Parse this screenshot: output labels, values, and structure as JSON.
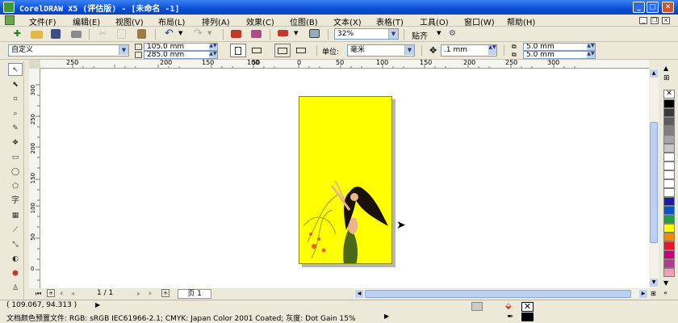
{
  "title": "CorelDRAW X5 (评估版) - [未命名 -1]",
  "window_buttons": {
    "minimize": "_",
    "maximize": "□",
    "close": "✕"
  },
  "menu": [
    "文件(F)",
    "编辑(E)",
    "视图(V)",
    "布局(L)",
    "排列(A)",
    "效果(C)",
    "位图(B)",
    "文本(X)",
    "表格(T)",
    "工具(O)",
    "窗口(W)",
    "帮助(H)"
  ],
  "toolbar": {
    "zoom": "32%",
    "snap": "贴齐"
  },
  "property_bar": {
    "paper_preset": "自定义",
    "width": "105.0 mm",
    "height": "285.0 mm",
    "unit_label": "单位:",
    "unit": "毫米",
    "nudge": ".1 mm",
    "dup_x": "5.0 mm",
    "dup_y": "5.0 mm"
  },
  "ruler": {
    "h_ticks": [
      "250",
      "200",
      "150",
      "100",
      "50",
      "0",
      "50",
      "100",
      "150",
      "200",
      "250",
      "300"
    ],
    "v_ticks": [
      "300",
      "250",
      "200",
      "150",
      "100",
      "50",
      "0"
    ]
  },
  "page_nav": {
    "position": "1 / 1",
    "tab": "页 1"
  },
  "status": {
    "coords": "( 109.067, 94.313 )",
    "profile": "文档颜色预置文件: RGB: sRGB IEC61966-2.1; CMYK: Japan Color 2001 Coated; 灰度: Dot Gain 15%"
  },
  "palette": [
    "#000000",
    "#3a3a3a",
    "#5e5e5e",
    "#808080",
    "#a5a5a5",
    "#c8c8c8",
    "#ffffff",
    "#ffffff",
    "#ffffff",
    "#ffffff",
    "#ffffff",
    "#1a1aa6",
    "#0a52c8",
    "#18a043",
    "#ffff00",
    "#f08800",
    "#e8142a",
    "#c8007a",
    "#b43c8c",
    "#f0a0b4"
  ],
  "colors": {
    "page_fill": "#ffff00",
    "titlebar": "#0a4fd6"
  }
}
